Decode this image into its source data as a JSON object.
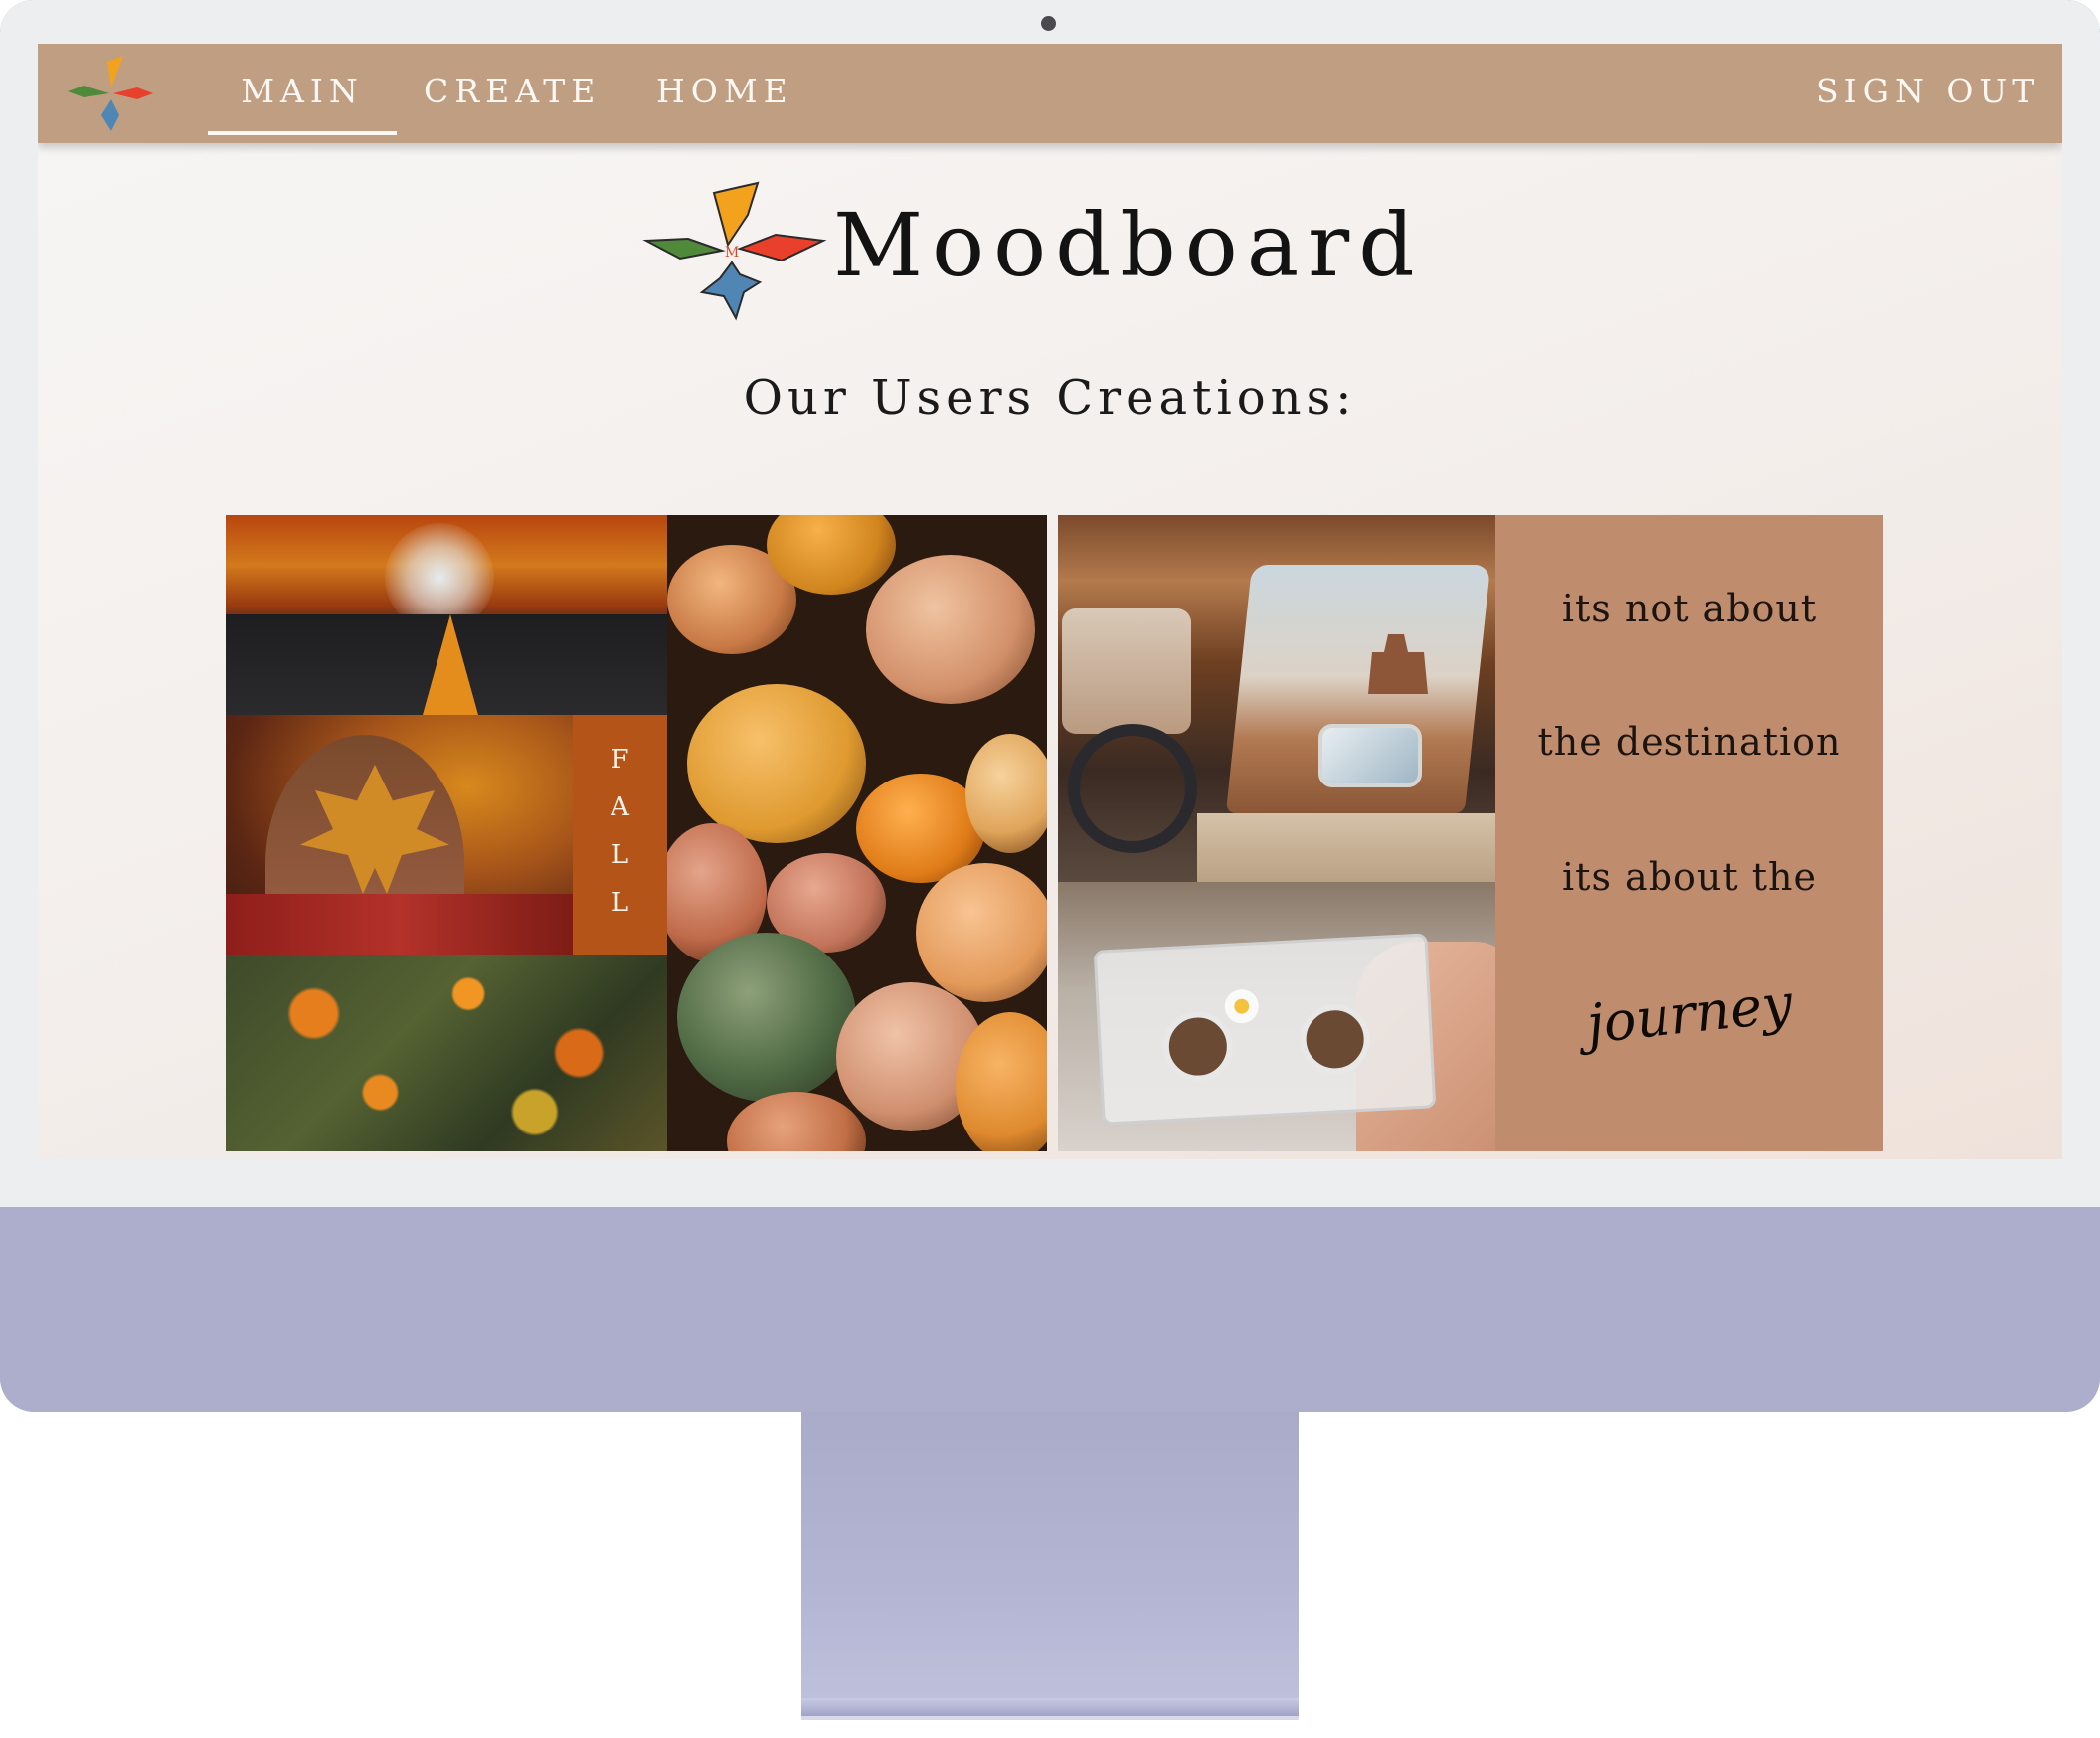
{
  "navbar": {
    "links": {
      "main": "MAIN",
      "create": "CREATE",
      "home": "HOME",
      "sign_out": "SIGN OUT"
    },
    "active_link": "MAIN"
  },
  "brand": {
    "title": "Moodboard",
    "logo_letter": "M"
  },
  "gallery": {
    "heading": "Our Users Creations:",
    "boards": [
      {
        "label_letters": [
          "F",
          "A",
          "L",
          "L"
        ]
      },
      {
        "quote_lines": [
          "its not about",
          "the destination",
          "its about the"
        ],
        "script_word": "journey"
      }
    ]
  },
  "colors": {
    "navbar": "#bf9e82",
    "nav_text": "#fbf7f2",
    "logo_orange": "#f3a21e",
    "logo_green": "#4f8a3a",
    "logo_red": "#e8402a",
    "logo_blue": "#4f86b4",
    "fall_tile": "#b55419",
    "quote_tile": "#bf8d6e",
    "monitor_body": "#acaecb"
  },
  "icons": {
    "nav_logo": "moodboard-logo-icon",
    "hero_logo": "moodboard-logo-icon",
    "camera": "camera-dot-icon"
  }
}
